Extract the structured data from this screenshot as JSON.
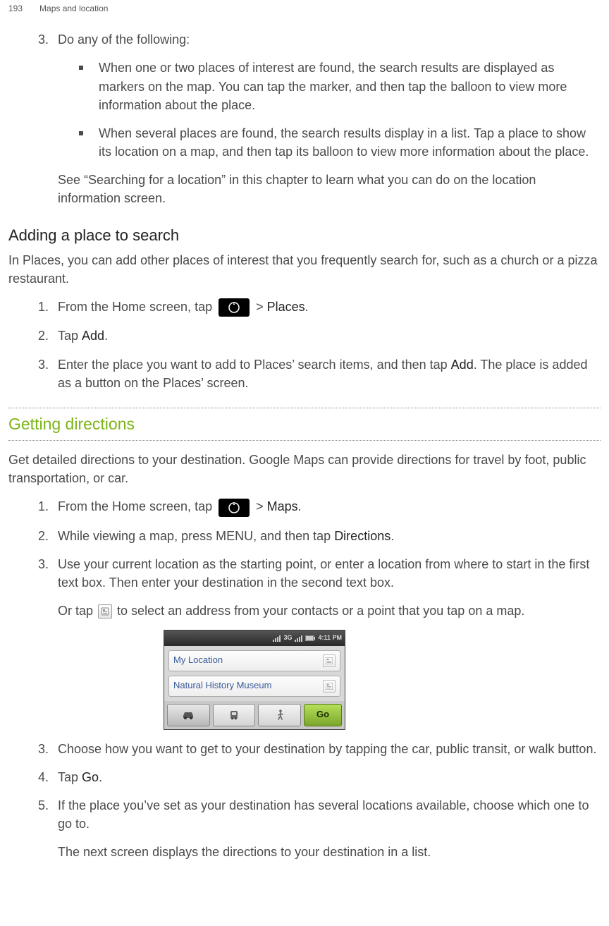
{
  "header": {
    "page_number": "193",
    "chapter": "Maps and location"
  },
  "sec1": {
    "step3_num": "3.",
    "step3_text": "Do any of the following:",
    "bullet1": "When one or two places of interest are found, the search results are displayed as markers on the map. You can tap the marker, and then tap the balloon to view more information about the place.",
    "bullet2": "When several places are found, the search results display in a list. Tap a place to show its location on a map, and then tap its balloon to view more information about the place.",
    "note": "See “Searching for a location” in this chapter to learn what you can do on the location information screen."
  },
  "sec2": {
    "heading": "Adding a place to search",
    "intro": "In Places, you can add other places of interest that you frequently search for, such as a church or a pizza restaurant.",
    "s1_num": "1.",
    "s1_a": "From the Home screen, tap ",
    "s1_b": " > ",
    "s1_places": "Places",
    "s1_c": ".",
    "s2_num": "2.",
    "s2_a": "Tap ",
    "s2_add": "Add",
    "s2_b": ".",
    "s3_num": "3.",
    "s3_a": "Enter the place you want to add to Places’ search items, and then tap ",
    "s3_add": "Add",
    "s3_b": ". The place is added as a button on the Places’ screen."
  },
  "sec3": {
    "heading": "Getting directions",
    "intro": "Get detailed directions to your destination. Google Maps can provide directions for travel by foot, public transportation, or car.",
    "s1_num": "1.",
    "s1_a": "From the Home screen, tap ",
    "s1_b": " > ",
    "s1_maps": "Maps",
    "s1_c": ".",
    "s2_num": "2.",
    "s2_a": "While viewing a map, press MENU, and then tap ",
    "s2_dir": "Directions",
    "s2_b": ".",
    "s3_num": "3.",
    "s3_a": "Use your current location as the starting point, or enter a location from where to start in the first text box. Then enter your destination in the second text box.",
    "s3_or_a": "Or tap ",
    "s3_or_b": " to select an address from your contacts or a point that you tap on a map.",
    "s3b_num": "3.",
    "s3b_text": "Choose how you want to get to your destination by tapping the car, public transit, or walk button.",
    "s4_num": "4.",
    "s4_a": "Tap ",
    "s4_go": "Go",
    "s4_b": ".",
    "s5_num": "5.",
    "s5_text": "If the place you’ve set as your destination has several locations available, choose which one to go to.",
    "s5_note": "The next screen displays the directions to your destination in a list."
  },
  "screenshot": {
    "statusbar_3g": "3G",
    "time": "4:11 PM",
    "field1": "My Location",
    "field2": "Natural History Museum",
    "go": "Go"
  }
}
